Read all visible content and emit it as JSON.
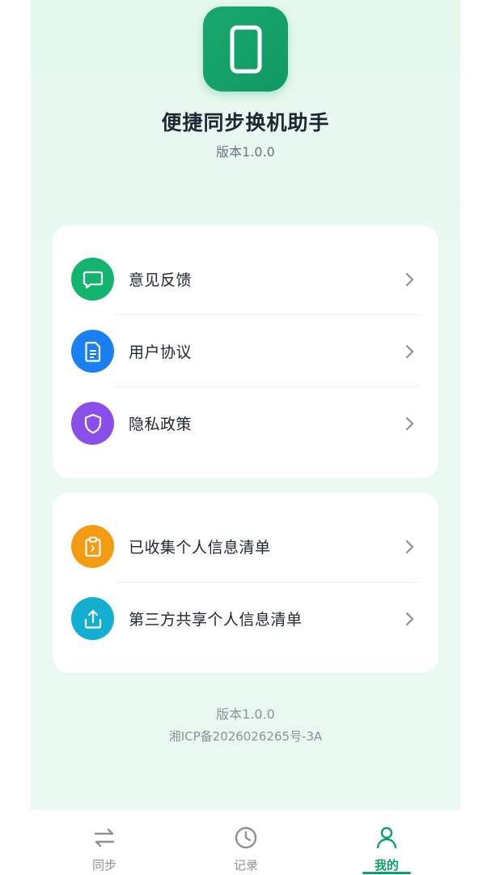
{
  "header": {
    "app_icon": "phone-outline-icon",
    "title": "便捷同步换机助手",
    "version": "版本1.0.0"
  },
  "colors": {
    "accent": "#12a06a",
    "feedback": "#13b46e",
    "agreement": "#1a7ff0",
    "privacy": "#8a4fe8",
    "collected": "#f39c12",
    "third_party": "#14aed1"
  },
  "menu_group_1": [
    {
      "label": "意见反馈",
      "icon": "chat-bubble-icon"
    },
    {
      "label": "用户协议",
      "icon": "document-icon"
    },
    {
      "label": "隐私政策",
      "icon": "shield-icon"
    }
  ],
  "menu_group_2": [
    {
      "label": "已收集个人信息清单",
      "icon": "clipboard-icon"
    },
    {
      "label": "第三方共享个人信息清单",
      "icon": "upload-icon"
    }
  ],
  "footer": {
    "version": "版本1.0.0",
    "icp": "湘ICP备2026026265号-3A"
  },
  "tabbar": {
    "tabs": [
      {
        "label": "同步",
        "icon": "swap-arrows-icon",
        "active": false
      },
      {
        "label": "记录",
        "icon": "clock-icon",
        "active": false
      },
      {
        "label": "我的",
        "icon": "person-icon",
        "active": true
      }
    ]
  }
}
